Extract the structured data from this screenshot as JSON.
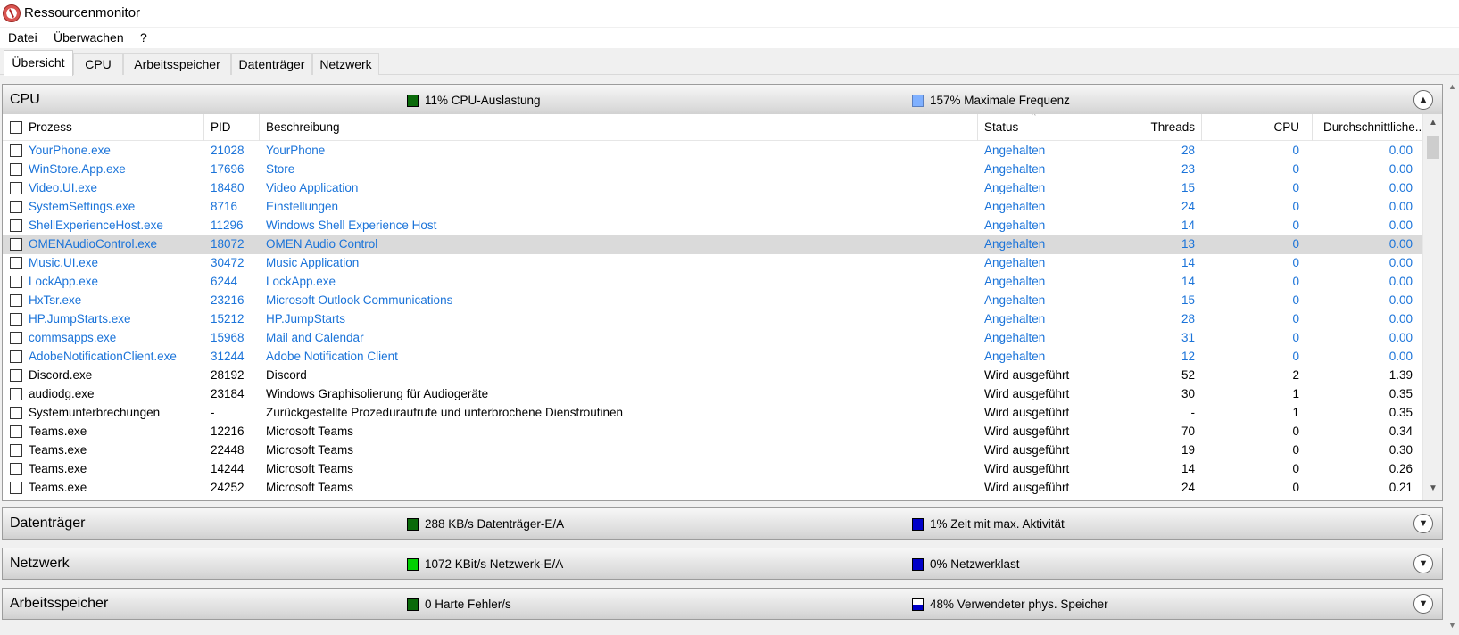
{
  "window": {
    "title": "Ressourcenmonitor"
  },
  "menu": [
    "Datei",
    "Überwachen",
    "?"
  ],
  "tabs": [
    "Übersicht",
    "CPU",
    "Arbeitsspeicher",
    "Datenträger",
    "Netzwerk"
  ],
  "colors": {
    "green": "#00c800",
    "dark_green": "#0a5a0a",
    "blue": "#0000c8",
    "light_blue": "#7fb0ff",
    "link_blue": "#1a73d9"
  },
  "cpu": {
    "title": "CPU",
    "metric1": "11% CPU-Auslastung",
    "metric2": "157% Maximale Frequenz",
    "columns": [
      "Prozess",
      "PID",
      "Beschreibung",
      "Status",
      "Threads",
      "CPU",
      "Durchschnittliche..."
    ],
    "rows": [
      [
        "YourPhone.exe",
        "21028",
        "YourPhone",
        "Angehalten",
        "28",
        "0",
        "0.00"
      ],
      [
        "WinStore.App.exe",
        "17696",
        "Store",
        "Angehalten",
        "23",
        "0",
        "0.00"
      ],
      [
        "Video.UI.exe",
        "18480",
        "Video Application",
        "Angehalten",
        "15",
        "0",
        "0.00"
      ],
      [
        "SystemSettings.exe",
        "8716",
        "Einstellungen",
        "Angehalten",
        "24",
        "0",
        "0.00"
      ],
      [
        "ShellExperienceHost.exe",
        "11296",
        "Windows Shell Experience Host",
        "Angehalten",
        "14",
        "0",
        "0.00"
      ],
      [
        "OMENAudioControl.exe",
        "18072",
        "OMEN Audio Control",
        "Angehalten",
        "13",
        "0",
        "0.00"
      ],
      [
        "Music.UI.exe",
        "30472",
        "Music Application",
        "Angehalten",
        "14",
        "0",
        "0.00"
      ],
      [
        "LockApp.exe",
        "6244",
        "LockApp.exe",
        "Angehalten",
        "14",
        "0",
        "0.00"
      ],
      [
        "HxTsr.exe",
        "23216",
        "Microsoft Outlook Communications",
        "Angehalten",
        "15",
        "0",
        "0.00"
      ],
      [
        "HP.JumpStarts.exe",
        "15212",
        "HP.JumpStarts",
        "Angehalten",
        "28",
        "0",
        "0.00"
      ],
      [
        "commsapps.exe",
        "15968",
        "Mail and Calendar",
        "Angehalten",
        "31",
        "0",
        "0.00"
      ],
      [
        "AdobeNotificationClient.exe",
        "31244",
        "Adobe Notification Client",
        "Angehalten",
        "12",
        "0",
        "0.00"
      ],
      [
        "Discord.exe",
        "28192",
        "Discord",
        "Wird ausgeführt",
        "52",
        "2",
        "1.39"
      ],
      [
        "audiodg.exe",
        "23184",
        "Windows Graphisolierung für Audiogeräte",
        "Wird ausgeführt",
        "30",
        "1",
        "0.35"
      ],
      [
        "Systemunterbrechungen",
        "-",
        "Zurückgestellte Prozeduraufrufe und unterbrochene Dienstroutinen",
        "Wird ausgeführt",
        "-",
        "1",
        "0.35"
      ],
      [
        "Teams.exe",
        "12216",
        "Microsoft Teams",
        "Wird ausgeführt",
        "70",
        "0",
        "0.34"
      ],
      [
        "Teams.exe",
        "22448",
        "Microsoft Teams",
        "Wird ausgeführt",
        "19",
        "0",
        "0.30"
      ],
      [
        "Teams.exe",
        "14244",
        "Microsoft Teams",
        "Wird ausgeführt",
        "14",
        "0",
        "0.26"
      ],
      [
        "Teams.exe",
        "24252",
        "Microsoft Teams",
        "Wird ausgeführt",
        "24",
        "0",
        "0.21"
      ]
    ],
    "suspended_count": 12,
    "selected_process": "OMENAudioControl.exe"
  },
  "disk": {
    "title": "Datenträger",
    "metric1": "288 KB/s Datenträger-E/A",
    "metric2": "1% Zeit mit max. Aktivität"
  },
  "network": {
    "title": "Netzwerk",
    "metric1": "1072 KBit/s Netzwerk-E/A",
    "metric2": "0% Netzwerklast"
  },
  "memory": {
    "title": "Arbeitsspeicher",
    "metric1": "0 Harte Fehler/s",
    "metric2": "48% Verwendeter phys. Speicher"
  }
}
